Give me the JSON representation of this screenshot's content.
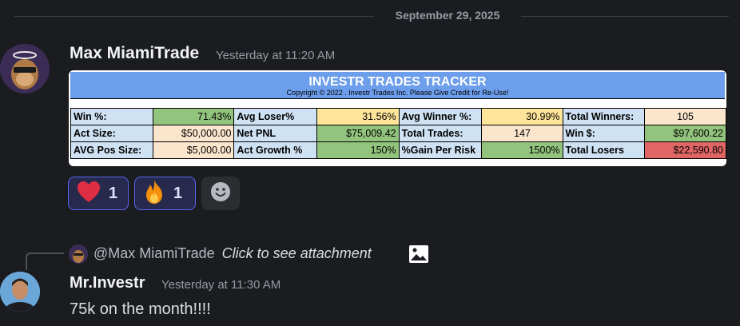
{
  "divider": {
    "date": "September 29, 2025"
  },
  "message1": {
    "username": "Max MiamiTrade",
    "timestamp": "Yesterday at 11:20 AM",
    "attachment": {
      "title": "INVESTR TRADES TRACKER",
      "copyright": "Copyright © 2022 . Investr Trades Inc. Please Give Credit for Re-Use!",
      "rows": [
        [
          "Win %:",
          "71.43%",
          "Avg Loser%",
          "31.56%",
          "Avg Winner %:",
          "30.99%",
          "Total Winners:",
          "105"
        ],
        [
          "Act Size:",
          "$50,000.00",
          "Net PNL",
          "$75,009.42",
          "Total Trades:",
          "147",
          "Win $:",
          "$97,600.22"
        ],
        [
          "AVG Pos Size:",
          "$5,000.00",
          "Act Growth %",
          "150%",
          "%Gain Per Risk",
          "1500%",
          "Total Losers",
          "$22,590.80"
        ]
      ]
    },
    "reactions": [
      {
        "emoji": "heart",
        "count": "1"
      },
      {
        "emoji": "fire",
        "count": "1"
      }
    ],
    "add_reaction_icon": "smiley-icon"
  },
  "reply": {
    "mention": "@Max MiamiTrade",
    "attachment_text": "Click to see attachment",
    "icon": "image-icon"
  },
  "message2": {
    "username": "Mr.Investr",
    "timestamp": "Yesterday at 11:30 AM",
    "text": "75k on the month!!!!"
  },
  "colors": {
    "background": "#1b1c20",
    "title_bar": "#6d9eeb",
    "reaction_border": "#5865f2",
    "green_cell": "#93c47d",
    "red_cell": "#e06666"
  }
}
